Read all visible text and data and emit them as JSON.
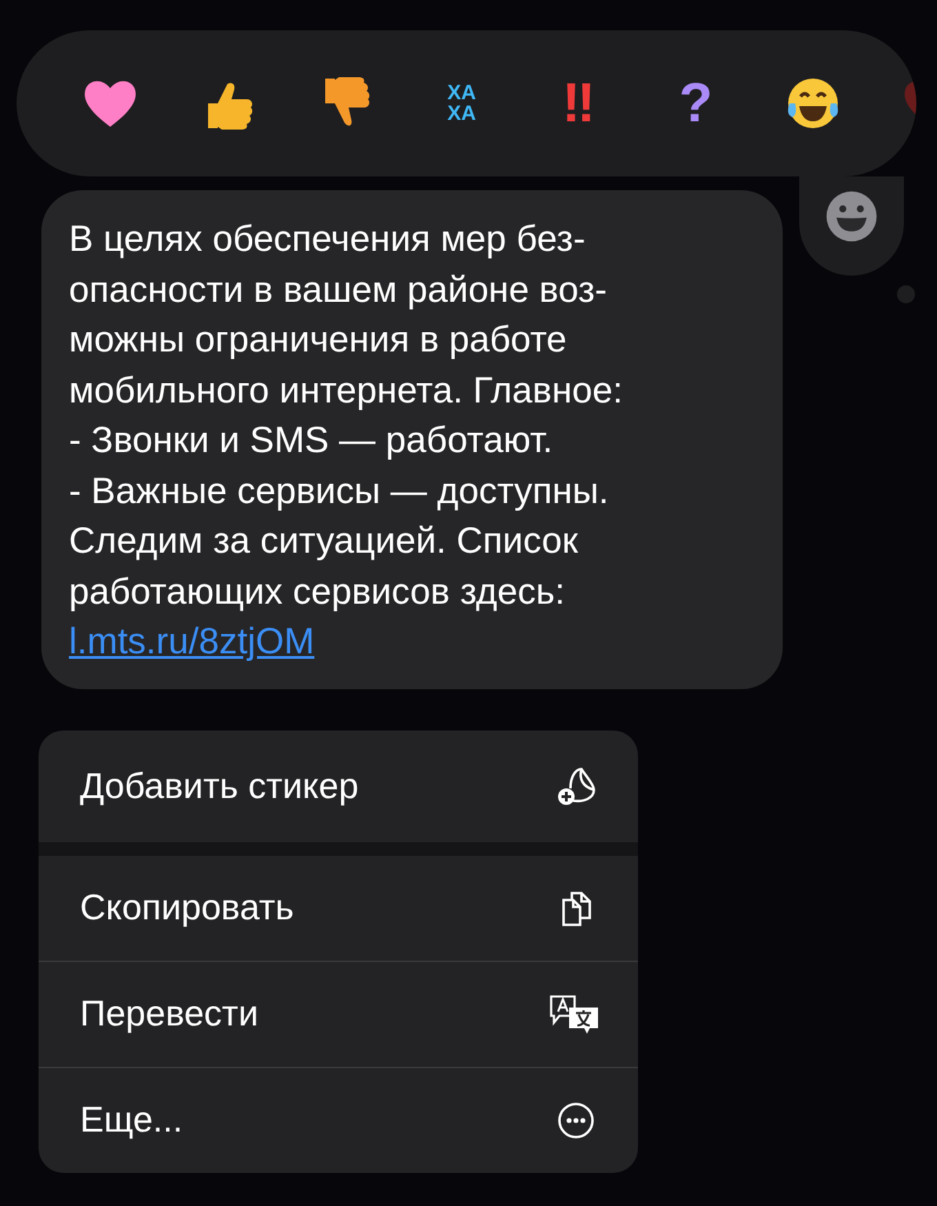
{
  "reactions": [
    {
      "kind": "heart"
    },
    {
      "kind": "thumbs-up"
    },
    {
      "kind": "thumbs-down"
    },
    {
      "kind": "haha",
      "lines": [
        "ХА",
        "ХА"
      ]
    },
    {
      "kind": "exclaim",
      "text": "‼"
    },
    {
      "kind": "question",
      "text": "?"
    },
    {
      "kind": "laugh"
    },
    {
      "kind": "heart-partial"
    }
  ],
  "message": {
    "text": "В целях обеспечения мер без-\nопасности в вашем районе воз-\nможны ограничения в работе\nмобильного интернета. Главное:\n- Звонки и SMS — работают.\n- Важные сервисы — доступны.\nСледим за ситуацией. Список\nработающих сервисов здесь:",
    "link": "l.mts.ru/8ztjOM"
  },
  "menu": [
    {
      "label": "Добавить стикер",
      "kind": "sticker"
    },
    {
      "label": "Скопировать",
      "kind": "copy"
    },
    {
      "label": "Перевести",
      "kind": "translate"
    },
    {
      "label": "Еще...",
      "kind": "more"
    }
  ]
}
